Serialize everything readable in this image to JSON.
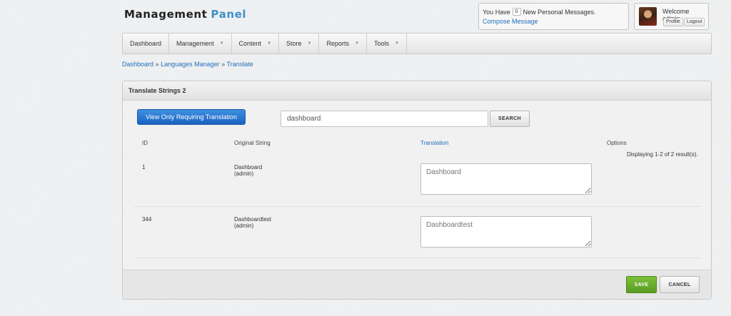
{
  "header": {
    "logo_main": "Management",
    "logo_accent": "Panel",
    "messages": {
      "prefix": "You Have",
      "count": "0",
      "suffix": "New Personal Messages.",
      "compose_link": "Compose Message"
    },
    "user": {
      "welcome": "Welcome admin",
      "profile_label": "Profile",
      "logout_label": "Logout"
    }
  },
  "nav": {
    "items": [
      {
        "label": "Dashboard",
        "has_dropdown": false
      },
      {
        "label": "Management",
        "has_dropdown": true
      },
      {
        "label": "Content",
        "has_dropdown": true
      },
      {
        "label": "Store",
        "has_dropdown": true
      },
      {
        "label": "Reports",
        "has_dropdown": true
      },
      {
        "label": "Tools",
        "has_dropdown": true
      }
    ]
  },
  "breadcrumb": {
    "items": [
      "Dashboard",
      "Languages Manager",
      "Translate"
    ],
    "separator": "»"
  },
  "panel": {
    "title": "Translate Strings 2",
    "filter_button": "View Only Requiring Translation",
    "search": {
      "value": "dashboard",
      "button": "SEARCH"
    },
    "columns": {
      "id": "ID",
      "original": "Original String",
      "translation": "Translation",
      "options": "Options"
    },
    "result_count": "Displaying 1-2 of 2 result(s).",
    "rows": [
      {
        "id": "1",
        "original": "Dashboard",
        "context": "(admin)",
        "translation_placeholder": "Dashboard"
      },
      {
        "id": "344",
        "original": "Dashboardtest",
        "context": "(admin)",
        "translation_placeholder": "Dashboardtest"
      }
    ],
    "save_button": "SAVE",
    "cancel_button": "CANCEL"
  },
  "colors": {
    "accent_blue": "#1a63c2",
    "save_green": "#5a9b22",
    "link_blue": "#1f6fb8",
    "logo_accent": "#3f92c8"
  }
}
